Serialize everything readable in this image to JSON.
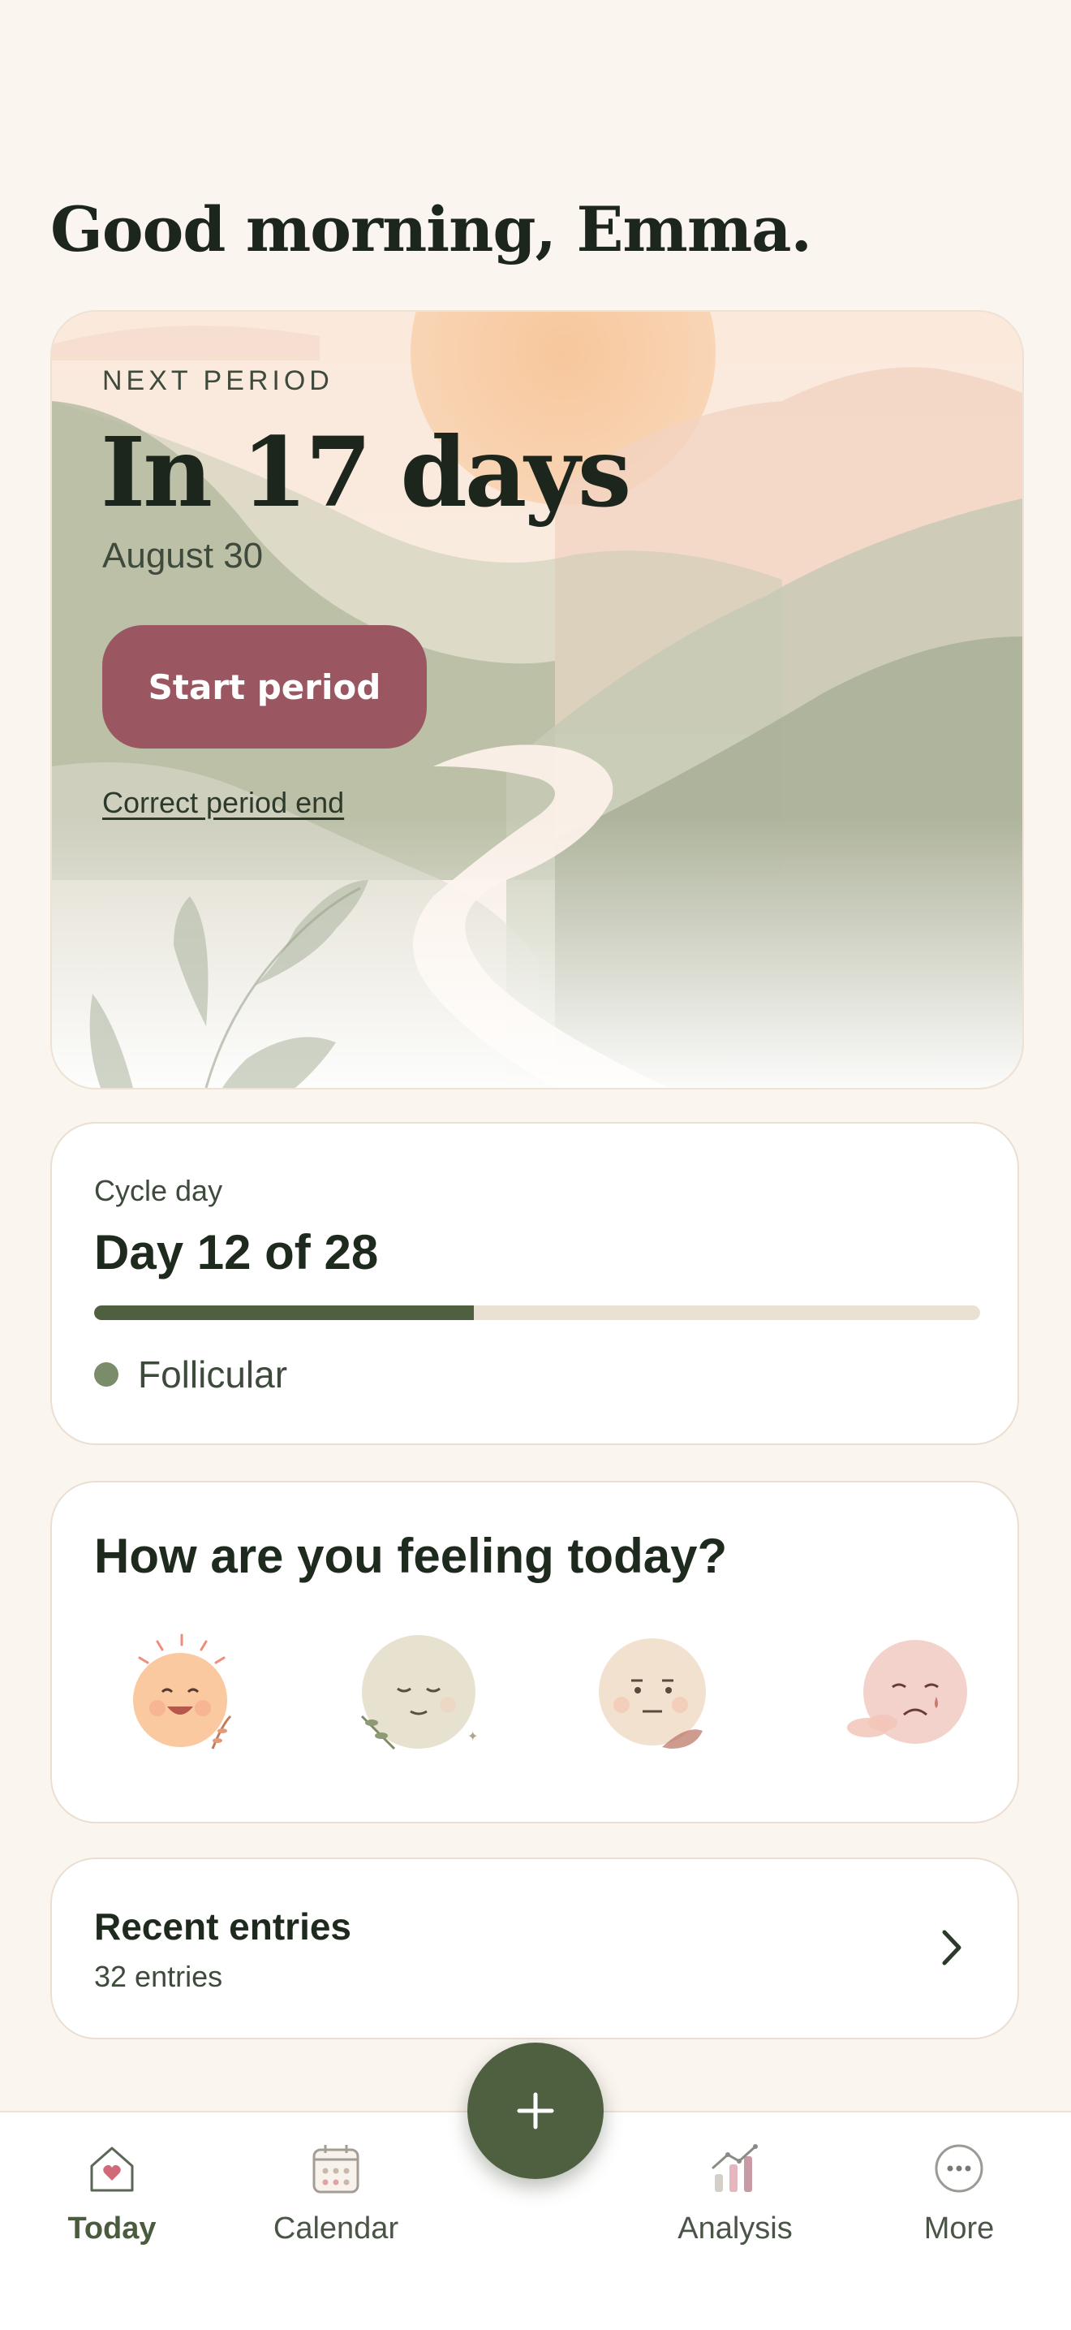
{
  "greeting": "Good morning, Emma.",
  "next_period": {
    "label": "NEXT PERIOD",
    "countdown": "In 17 days",
    "date": "August 30",
    "start_button": "Start period",
    "correct_link": "Correct period end"
  },
  "cycle": {
    "label": "Cycle day",
    "day_text": "Day 12 of 28",
    "progress_fraction": 0.4286,
    "phase": "Follicular",
    "phase_color": "#7a8c69",
    "progress_color": "#4f6041"
  },
  "mood": {
    "question": "How are you feeling today?",
    "options": [
      {
        "icon": "happy-sun-face-icon"
      },
      {
        "icon": "calm-face-icon"
      },
      {
        "icon": "neutral-face-icon"
      },
      {
        "icon": "sad-face-icon"
      }
    ]
  },
  "recent": {
    "title": "Recent entries",
    "count": "32 entries"
  },
  "nav": {
    "items": [
      {
        "label": "Today",
        "icon": "home-heart-icon",
        "active": true
      },
      {
        "label": "Calendar",
        "icon": "calendar-icon",
        "active": false
      },
      {
        "label": "Analysis",
        "icon": "bar-chart-icon",
        "active": false
      },
      {
        "label": "More",
        "icon": "more-dots-icon",
        "active": false
      }
    ],
    "fab_icon": "plus-icon"
  },
  "colors": {
    "background": "#faf5ef",
    "accent": "#4f6041",
    "start_button": "#9a5762"
  }
}
